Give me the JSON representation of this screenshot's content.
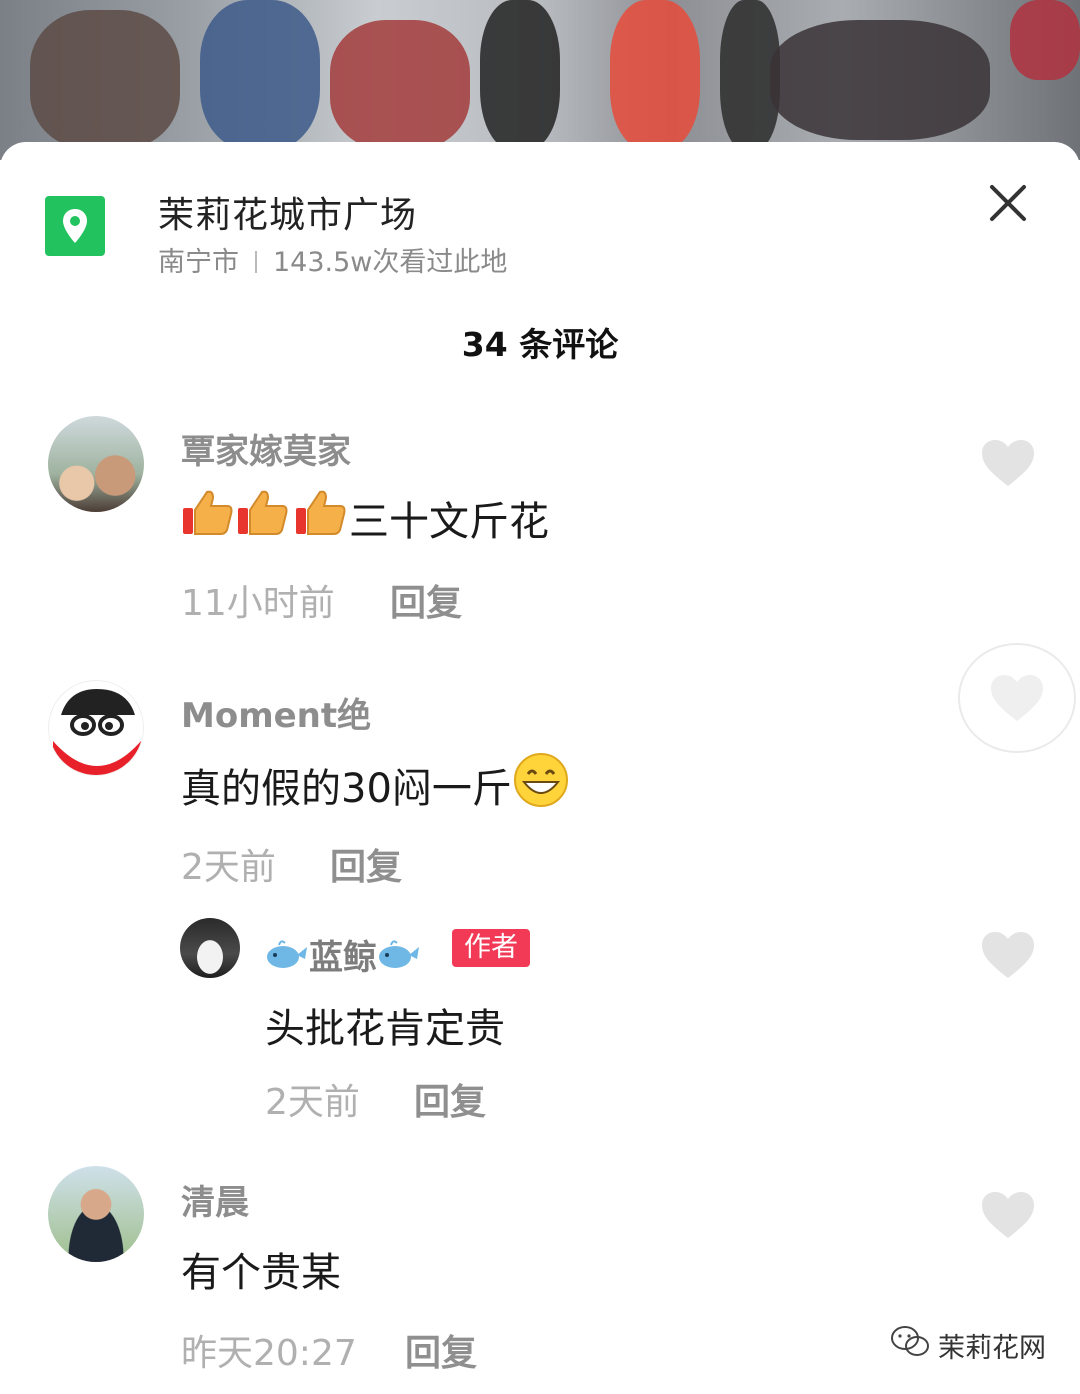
{
  "location": {
    "title": "茉莉花城市广场",
    "city": "南宁市",
    "views": "143.5w次看过此地",
    "icon": "map-pin-icon"
  },
  "comment_count": "34 条评论",
  "comments": [
    {
      "username": "覃家嫁莫家",
      "text": "三十文斤花",
      "time": "11小时前",
      "reply": "回复"
    },
    {
      "username": "Moment绝",
      "text": "真的假的30闷一斤",
      "time": "2天前",
      "reply": "回复",
      "sub_reply": {
        "username": "蓝鲸",
        "badge": "作者",
        "text": "头批花肯定贵",
        "time": "2天前",
        "reply": "回复"
      }
    },
    {
      "username": "清晨",
      "text": "有个贵某",
      "time": "昨天20:27",
      "reply": "回复"
    }
  ],
  "brand": "茉莉花网",
  "colors": {
    "accent_green": "#22c35e",
    "author_badge": "#f23a57"
  }
}
